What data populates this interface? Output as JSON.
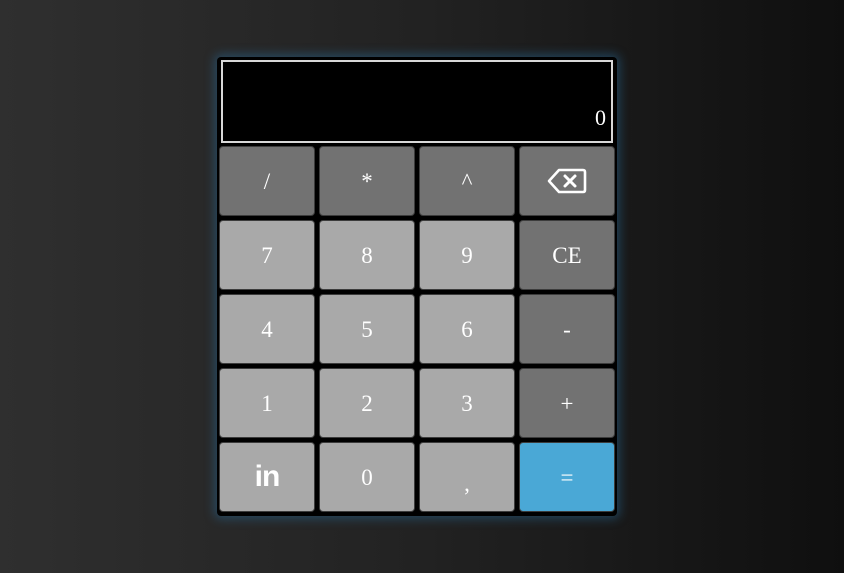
{
  "display": {
    "value": "0"
  },
  "keys": {
    "divide": "/",
    "multiply": "*",
    "power": "^",
    "backspace_icon": "backspace-icon",
    "seven": "7",
    "eight": "8",
    "nine": "9",
    "clear_entry": "CE",
    "four": "4",
    "five": "5",
    "six": "6",
    "minus": "-",
    "one": "1",
    "two": "2",
    "three": "3",
    "plus": "+",
    "linkedin_icon": "linkedin-icon",
    "zero": "0",
    "comma": ",",
    "equals": "="
  },
  "colors": {
    "operator_key": "#727272",
    "number_key": "#a9a9a9",
    "equals_key": "#4aa8d6",
    "display_bg": "#000000"
  }
}
